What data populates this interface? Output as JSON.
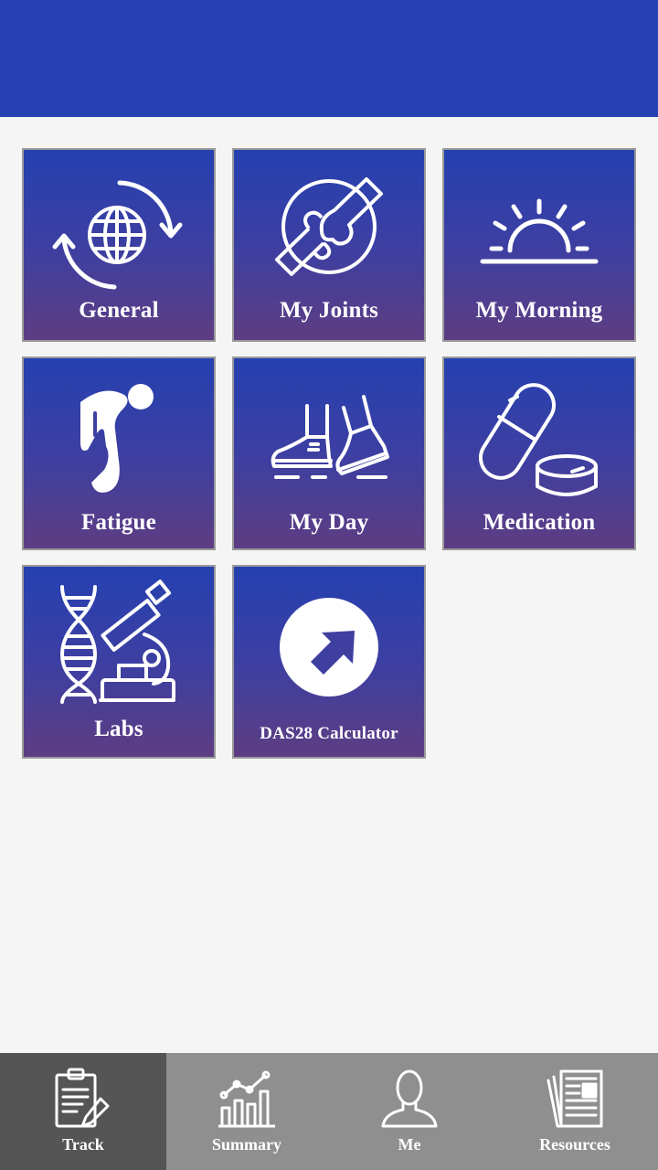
{
  "header": {
    "title": ""
  },
  "tiles": [
    {
      "label": "General",
      "icon": "globe-rotate-icon"
    },
    {
      "label": "My Joints",
      "icon": "joint-icon"
    },
    {
      "label": "My Morning",
      "icon": "sunrise-icon"
    },
    {
      "label": "Fatigue",
      "icon": "fatigue-icon"
    },
    {
      "label": "My Day",
      "icon": "walking-shoes-icon"
    },
    {
      "label": "Medication",
      "icon": "pill-icon"
    },
    {
      "label": "Labs",
      "icon": "dna-microscope-icon"
    },
    {
      "label": "DAS28 Calculator",
      "icon": "arrow-circle-icon"
    }
  ],
  "nav": {
    "items": [
      {
        "label": "Track",
        "icon": "clipboard-icon",
        "active": true
      },
      {
        "label": "Summary",
        "icon": "bar-chart-icon",
        "active": false
      },
      {
        "label": "Me",
        "icon": "person-icon",
        "active": false
      },
      {
        "label": "Resources",
        "icon": "newspaper-icon",
        "active": false
      }
    ]
  },
  "colors": {
    "header": "#2541b2",
    "tile_top": "#2540b1",
    "tile_bottom": "#5e3d82",
    "nav_bg": "#8f8f8f",
    "nav_active": "#555555"
  }
}
